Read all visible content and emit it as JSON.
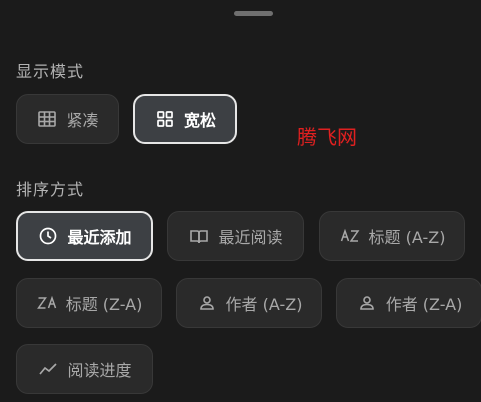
{
  "display_mode": {
    "label": "显示模式",
    "options": [
      {
        "label": "紧凑",
        "icon": "grid-table-icon",
        "selected": false
      },
      {
        "label": "宽松",
        "icon": "grid-four-icon",
        "selected": true
      }
    ]
  },
  "sort_mode": {
    "label": "排序方式",
    "options": [
      {
        "label": "最近添加",
        "icon": "clock-icon",
        "selected": true
      },
      {
        "label": "最近阅读",
        "icon": "open-book-icon",
        "selected": false
      },
      {
        "label": "标题 (A-Z)",
        "icon": "sort-alpha-asc-icon",
        "selected": false
      },
      {
        "label": "标题 (Z-A)",
        "icon": "sort-alpha-desc-icon",
        "selected": false
      },
      {
        "label": "作者 (A-Z)",
        "icon": "person-icon",
        "selected": false
      },
      {
        "label": "作者 (Z-A)",
        "icon": "person-icon",
        "selected": false
      },
      {
        "label": "阅读进度",
        "icon": "trend-line-icon",
        "selected": false
      }
    ]
  },
  "watermark": "腾飞网",
  "colors": {
    "background": "#1b1b1b",
    "chip": "#2a2a2a",
    "chip_selected": "#3d4044",
    "selected_border": "#e6e6e6",
    "watermark": "#e02020"
  }
}
